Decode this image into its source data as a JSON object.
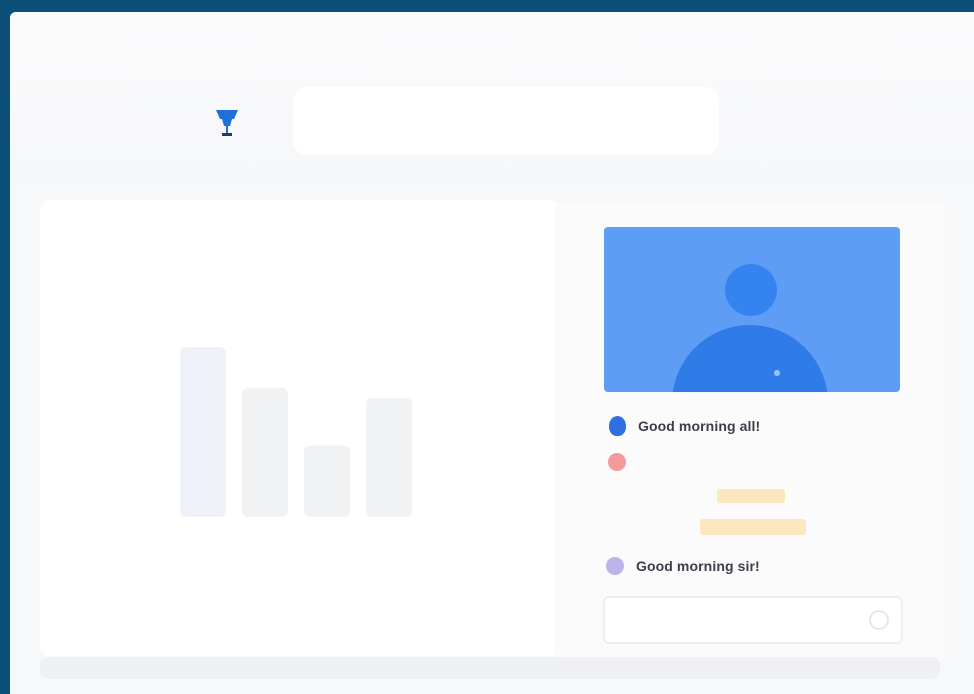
{
  "chat": {
    "messages": [
      {
        "text": "Good morning all!",
        "avatar_color": "#2f6fe0"
      },
      {
        "text": "",
        "avatar_color": "#f59a9a"
      },
      {
        "text": "Good morning sir!",
        "avatar_color": "#bfb3ec"
      }
    ],
    "input_placeholder": ""
  },
  "chart_data": {
    "type": "bar",
    "categories": [
      "",
      "",
      "",
      ""
    ],
    "values": [
      100,
      76,
      42,
      70
    ],
    "title": "",
    "xlabel": "",
    "ylabel": "",
    "ylim": [
      0,
      100
    ]
  },
  "colors": {
    "window_border": "#0c4f79",
    "video_tile": "#5e9df5",
    "avatar": "#2f7ce9"
  }
}
